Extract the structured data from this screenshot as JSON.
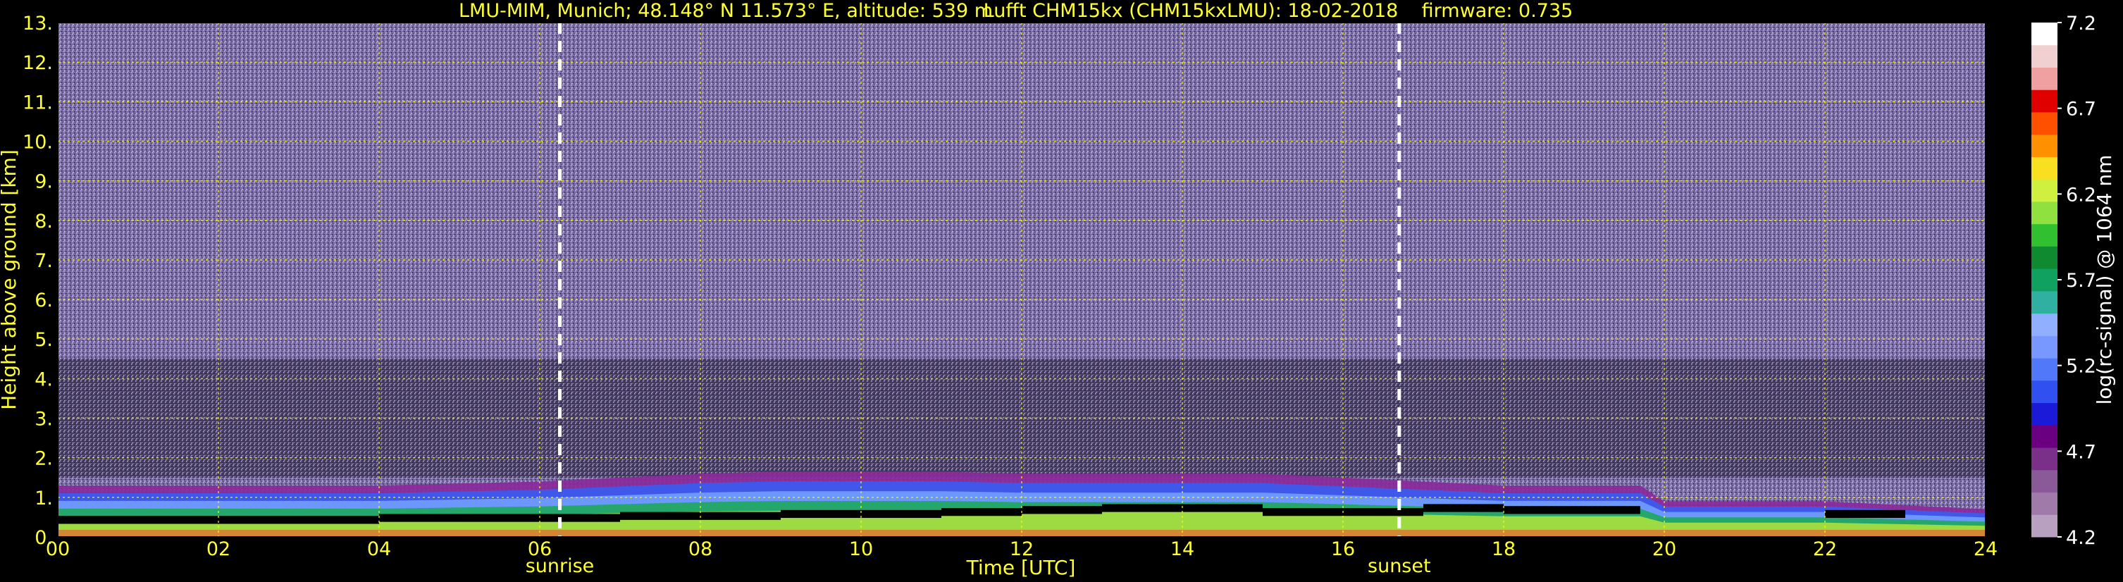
{
  "chart_data": {
    "type": "heatmap",
    "title_parts": [
      "LMU-MIM, Munich; 48.148° N 11.573° E, altitude: 539 m",
      "Lufft CHM15kx (CHM15kxLMU): 18-02-2018",
      "firmware: 0.735"
    ],
    "xlabel": "Time [UTC]",
    "ylabel": "Height above ground [km]",
    "colorbar_label": "log(rc-signal) @ 1064 nm",
    "xlim": [
      0,
      24
    ],
    "ylim": [
      0,
      13
    ],
    "clim": [
      4.2,
      7.2
    ],
    "x_ticks": [
      "00",
      "02",
      "04",
      "06",
      "08",
      "10",
      "12",
      "14",
      "16",
      "18",
      "20",
      "22",
      "24"
    ],
    "y_ticks": [
      "0.",
      "1.",
      "2.",
      "3.",
      "4.",
      "5.",
      "6.",
      "7.",
      "8.",
      "9.",
      "10.",
      "11.",
      "12.",
      "13."
    ],
    "colorbar_ticks": [
      "4.2",
      "4.7",
      "5.2",
      "5.7",
      "6.2",
      "6.7",
      "7.2"
    ],
    "grid": true,
    "grid_color": "#ffff00",
    "events": [
      {
        "label": "sunrise",
        "x": 6.25
      },
      {
        "label": "sunset",
        "x": 16.7
      }
    ],
    "colormap": [
      "#b8a0c0",
      "#a07aa8",
      "#8a5a98",
      "#7a3088",
      "#6a0080",
      "#1a1ad8",
      "#3050f0",
      "#5078f8",
      "#7898ff",
      "#90b0ff",
      "#30b0a0",
      "#10a060",
      "#108a30",
      "#30c030",
      "#90e040",
      "#d0f040",
      "#f8e020",
      "#ff9000",
      "#ff5000",
      "#e00000",
      "#f0a0a0",
      "#f0d0d0",
      "#ffffff"
    ],
    "background_color": "#7d6fa8",
    "layer_profile_hours": [
      0,
      1,
      2,
      3,
      4,
      5,
      6,
      7,
      8,
      9,
      10,
      11,
      12,
      13,
      14,
      15,
      16,
      17,
      18,
      19,
      19.7,
      20,
      21,
      22,
      23,
      24
    ],
    "aerosol_layer_top_km": [
      1.3,
      1.3,
      1.3,
      1.3,
      1.3,
      1.35,
      1.4,
      1.5,
      1.6,
      1.65,
      1.65,
      1.65,
      1.6,
      1.6,
      1.6,
      1.6,
      1.5,
      1.4,
      1.3,
      1.3,
      1.3,
      0.9,
      0.9,
      0.9,
      0.8,
      0.7
    ],
    "dark_layer_km": [
      0.45,
      0.45,
      0.45,
      0.45,
      0.5,
      0.5,
      0.5,
      0.55,
      0.55,
      0.6,
      0.6,
      0.65,
      0.7,
      0.75,
      0.75,
      0.65,
      0.65,
      0.75,
      0.7,
      0.7,
      0.0,
      0.0,
      0.0,
      0.6,
      0.0,
      0.0
    ]
  }
}
